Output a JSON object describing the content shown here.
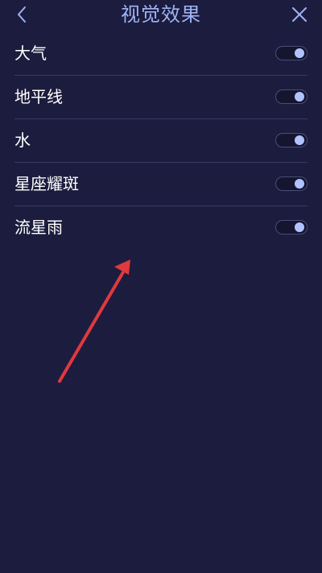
{
  "header": {
    "title": "视觉效果",
    "back_icon": "chevron-left-icon",
    "close_icon": "close-icon"
  },
  "settings": [
    {
      "label": "大气",
      "enabled": true
    },
    {
      "label": "地平线",
      "enabled": true
    },
    {
      "label": "水",
      "enabled": true
    },
    {
      "label": "星座耀斑",
      "enabled": true
    },
    {
      "label": "流星雨",
      "enabled": true
    }
  ],
  "colors": {
    "background": "#1c1c3e",
    "title": "#9fb3f5",
    "toggle_knob": "#b0c3ff",
    "annotation_arrow": "#e0393e"
  }
}
